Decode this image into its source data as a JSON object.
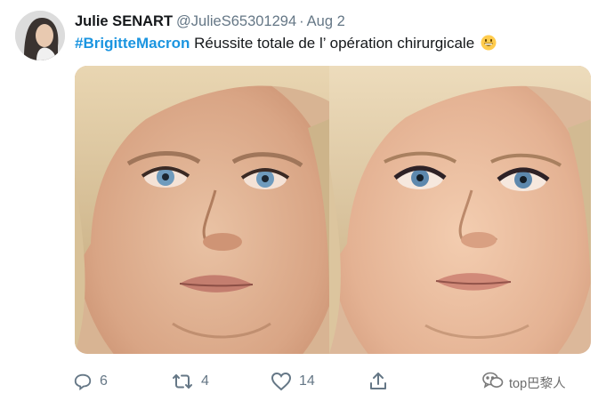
{
  "tweet": {
    "author_name": "Julie SENART",
    "author_handle": "@JulieS65301294",
    "separator": "·",
    "date": "Aug 2",
    "hashtag": "#BrigitteMacron",
    "text": "Réussite totale de l’  opération chirurgicale",
    "emoji": "grinning-face-emoji"
  },
  "actions": {
    "replies": "6",
    "retweets": "4",
    "likes": "14"
  },
  "watermark": {
    "label": "top巴黎人"
  },
  "icons": {
    "reply": "reply-icon",
    "retweet": "retweet-icon",
    "like": "heart-icon",
    "share": "share-icon"
  },
  "colors": {
    "link": "#1b95e0",
    "secondary_text": "#657786",
    "primary_text": "#14171a"
  }
}
